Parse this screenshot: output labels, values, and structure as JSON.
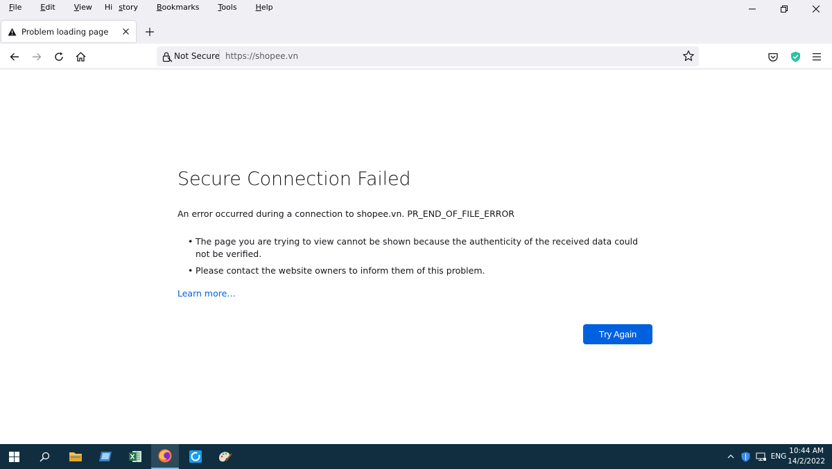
{
  "menubar": {
    "items": [
      {
        "pre": "",
        "u": "F",
        "post": "ile"
      },
      {
        "pre": "",
        "u": "E",
        "post": "dit"
      },
      {
        "pre": "",
        "u": "V",
        "post": "iew"
      },
      {
        "pre": "Hi",
        "u": "s",
        "post": "tory"
      },
      {
        "pre": "",
        "u": "B",
        "post": "ookmarks"
      },
      {
        "pre": "",
        "u": "T",
        "post": "ools"
      },
      {
        "pre": "",
        "u": "H",
        "post": "elp"
      }
    ]
  },
  "tab": {
    "title": "Problem loading page",
    "icon": "warning-icon"
  },
  "navbar": {
    "security_label": "Not Secure",
    "url": "https://shopee.vn"
  },
  "error_page": {
    "title": "Secure Connection Failed",
    "message": "An error occurred during a connection to shopee.vn. PR_END_OF_FILE_ERROR",
    "bullets": [
      "The page you are trying to view cannot be shown because the authenticity of the received data could not be verified.",
      "Please contact the website owners to inform them of this problem."
    ],
    "learn_more": "Learn more…",
    "try_again": "Try Again"
  },
  "taskbar": {
    "apps": [
      "start-icon",
      "search-icon",
      "file-explorer-icon",
      "monitor-app-icon",
      "excel-icon",
      "firefox-icon",
      "network-app-icon",
      "paint-app-icon"
    ],
    "language": "ENG",
    "time": "10:44 AM",
    "date": "14/2/2022"
  },
  "colors": {
    "accent": "#0061e0",
    "link": "#0060df",
    "taskbar": "#102e3f",
    "shield": "#2ac3a2"
  }
}
